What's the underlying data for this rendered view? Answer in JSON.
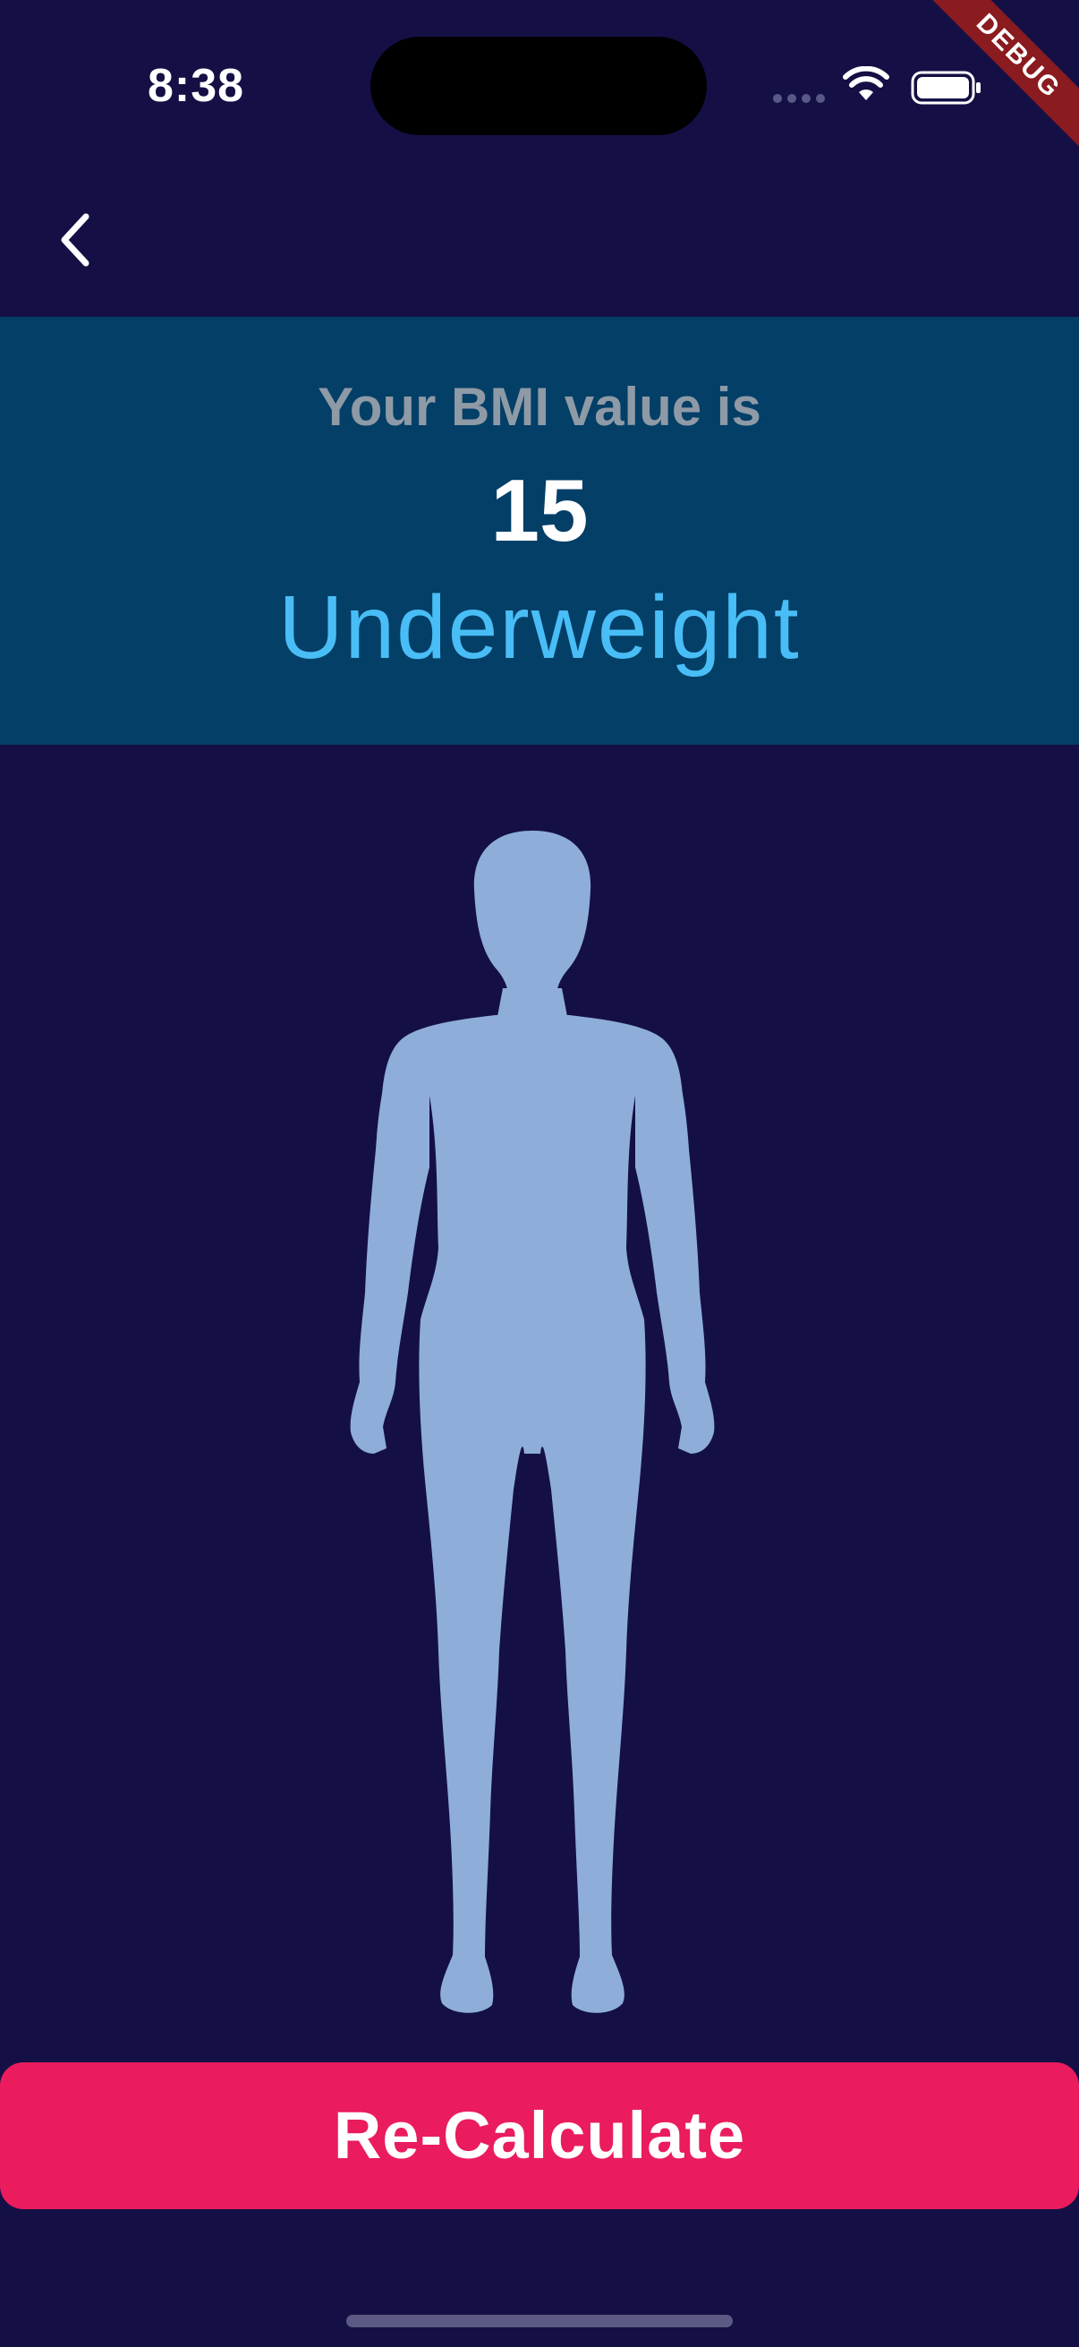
{
  "status_bar": {
    "time": "8:38"
  },
  "debug_banner": {
    "label": "DEBUG"
  },
  "app_bar": {
    "back_icon": "chevron-left-icon"
  },
  "result": {
    "heading": "Your BMI value is",
    "value": "15",
    "category": "Underweight"
  },
  "illustration": {
    "icon": "human-body-silhouette"
  },
  "actions": {
    "recalculate_label": "Re-Calculate"
  },
  "colors": {
    "background": "#141045",
    "result_panel": "#033f67",
    "heading_text": "#8e9aa6",
    "value_text": "#ffffff",
    "category_text": "#49bdf6",
    "silhouette": "#8eaed9",
    "button": "#ea1c5d",
    "debug_ribbon": "#8a1b1f"
  }
}
